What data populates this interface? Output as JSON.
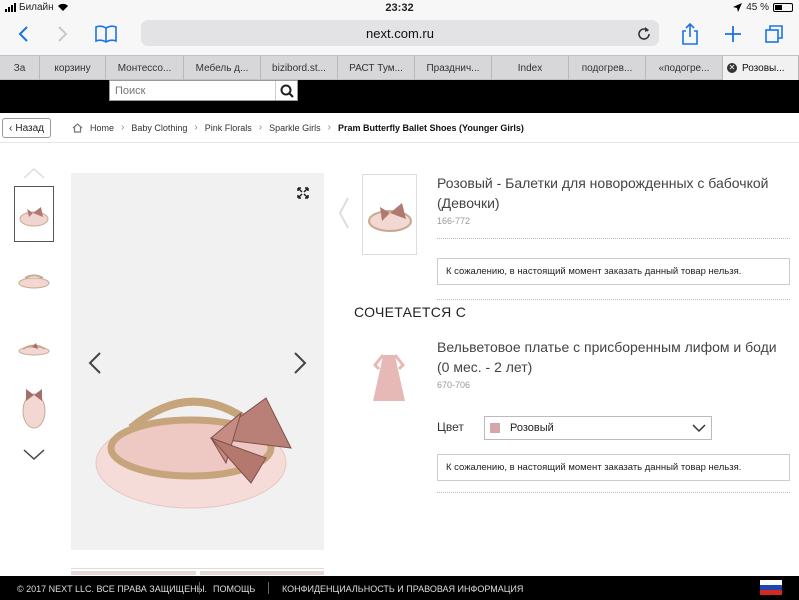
{
  "status": {
    "carrier": "Билайн",
    "time": "23:32",
    "battery": "45 %"
  },
  "browser": {
    "url": "next.com.ru",
    "tabs": [
      {
        "label": "За"
      },
      {
        "label": "корзину"
      },
      {
        "label": "Монтессо..."
      },
      {
        "label": "Мебель д..."
      },
      {
        "label": "bizibord.st..."
      },
      {
        "label": "РАСТ Тум..."
      },
      {
        "label": "Празднич..."
      },
      {
        "label": "Index"
      },
      {
        "label": "подогрев..."
      },
      {
        "label": "«подогре..."
      },
      {
        "label": "Розовы..."
      }
    ]
  },
  "site": {
    "search_placeholder": "Поиск",
    "back_label": "Назад",
    "breadcrumb": [
      "Home",
      "Baby Clothing",
      "Pink Florals",
      "Sparkle Girls",
      "Pram Butterfly Ballet Shoes (Younger Girls)"
    ]
  },
  "product": {
    "title": "Розовый - Балетки для новорожденных с бабочкой (Девочки)",
    "code": "166-772",
    "unavailable": "К сожалению, в настоящий момент заказать данный товар нельзя."
  },
  "matches": {
    "heading": "СОЧЕТАЕТСЯ С",
    "item_title": "Вельветовое платье с присборенным лифом и боди (0 мес. - 2 лет)",
    "item_code": "670-706",
    "color_label": "Цвет",
    "color_value": "Розовый",
    "unavailable": "К сожалению, в настоящий момент заказать данный товар нельзя."
  },
  "footer": {
    "copyright": "© 2017 NEXT LLC. ВСЕ ПРАВА ЗАЩИЩЕНЫ.",
    "help": "ПОМОЩЬ",
    "privacy": "КОНФИДЕНЦИАЛЬНОСТЬ И ПРАВОВАЯ ИНФОРМАЦИЯ"
  },
  "colors": {
    "accent": "#1a73e8",
    "swatch": "#d4a6a8",
    "header": "#000000"
  }
}
